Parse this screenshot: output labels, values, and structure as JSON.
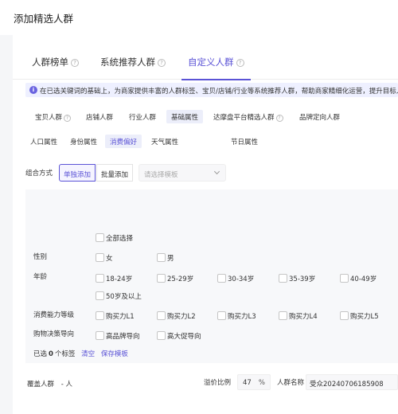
{
  "header": {
    "title": "添加精选人群"
  },
  "tabs": [
    {
      "label": "人群榜单",
      "help": true
    },
    {
      "label": "系统推荐人群",
      "help": true
    },
    {
      "label": "自定义人群",
      "help": true,
      "active": true
    }
  ],
  "notice": {
    "text": "在已选关键词的基础上，为商家提供丰富的人群标签、宝贝/店铺/行业等系统推荐人群，帮助商家精细化运营，提升目标人"
  },
  "categories": [
    {
      "label": "宝贝人群",
      "help": true
    },
    {
      "label": "店铺人群"
    },
    {
      "label": "行业人群"
    },
    {
      "label": "基础属性",
      "active": true
    },
    {
      "label": "达摩盘平台精选人群",
      "help": true
    },
    {
      "label": "品牌定向人群"
    }
  ],
  "subcategories": [
    {
      "label": "人口属性"
    },
    {
      "label": "身份属性"
    },
    {
      "label": "消费偏好",
      "active": true
    },
    {
      "label": "天气属性"
    },
    {
      "label": "节日属性"
    }
  ],
  "combo": {
    "label": "组合方式",
    "single": "单独添加",
    "batch": "批量添加",
    "template_placeholder": "请选择模板"
  },
  "attributes": {
    "select_all": "全部选择",
    "gender": {
      "label": "性别",
      "options": [
        "女",
        "男"
      ]
    },
    "age": {
      "label": "年龄",
      "options": [
        "18-24岁",
        "25-29岁",
        "30-34岁",
        "35-39岁",
        "40-49岁",
        "50岁及以上"
      ]
    },
    "spending": {
      "label": "消费能力等级",
      "options": [
        "购买力L1",
        "购买力L2",
        "购买力L3",
        "购买力L4",
        "购买力L5"
      ]
    },
    "decision": {
      "label": "购物决策导向",
      "options": [
        "高品牌导向",
        "高大促导向"
      ]
    },
    "selected": {
      "prefix": "已选",
      "count": "0",
      "suffix": "个标签",
      "clear": "清空",
      "save": "保存模板"
    }
  },
  "footer": {
    "coverage_label": "覆盖人群",
    "coverage_value": "- 人",
    "ratio_label": "溢价比例",
    "ratio_value": "47",
    "ratio_unit": "%",
    "name_label": "人群名称",
    "name_value": "受众20240706185908"
  },
  "colors": {
    "accent": "#5b53d6",
    "notice_bg": "#eef0ff"
  }
}
